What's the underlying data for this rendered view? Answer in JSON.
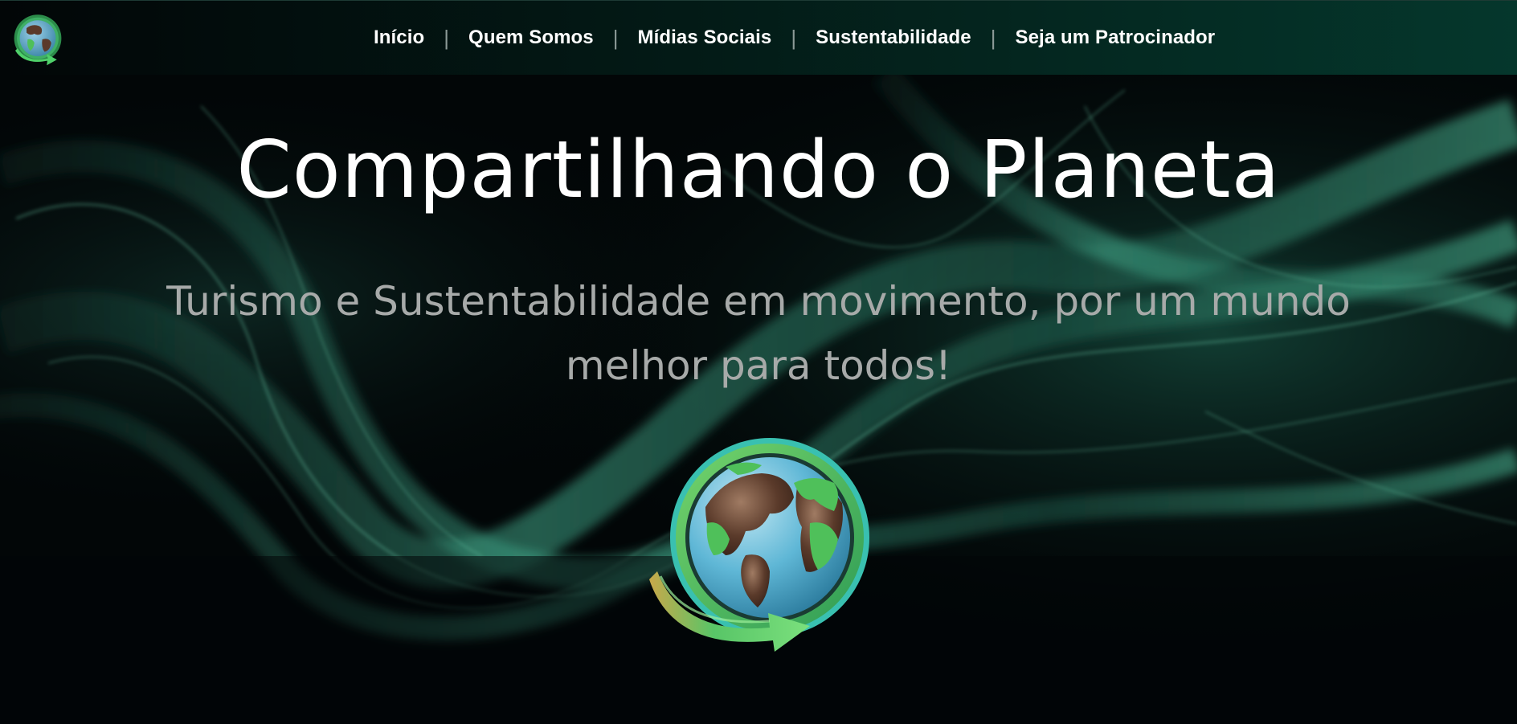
{
  "nav": {
    "logo_icon": "globe-arrow-logo",
    "items": [
      {
        "label": "Início"
      },
      {
        "label": "Quem Somos"
      },
      {
        "label": "Mídias Sociais"
      },
      {
        "label": "Sustentabilidade"
      },
      {
        "label": "Seja um Patrocinador"
      }
    ],
    "separator": "|"
  },
  "hero": {
    "title": "Compartilhando o Planeta",
    "subtitle": "Turismo e Sustentabilidade em movimento, por um mundo melhor para todos!",
    "logo_icon": "globe-arrow-logo"
  },
  "colors": {
    "background": "#020607",
    "nav_gradient_end": "#05372c",
    "smoke_green": "#3a9c80",
    "title": "#ffffff",
    "subtitle": "#a7aaa9"
  }
}
